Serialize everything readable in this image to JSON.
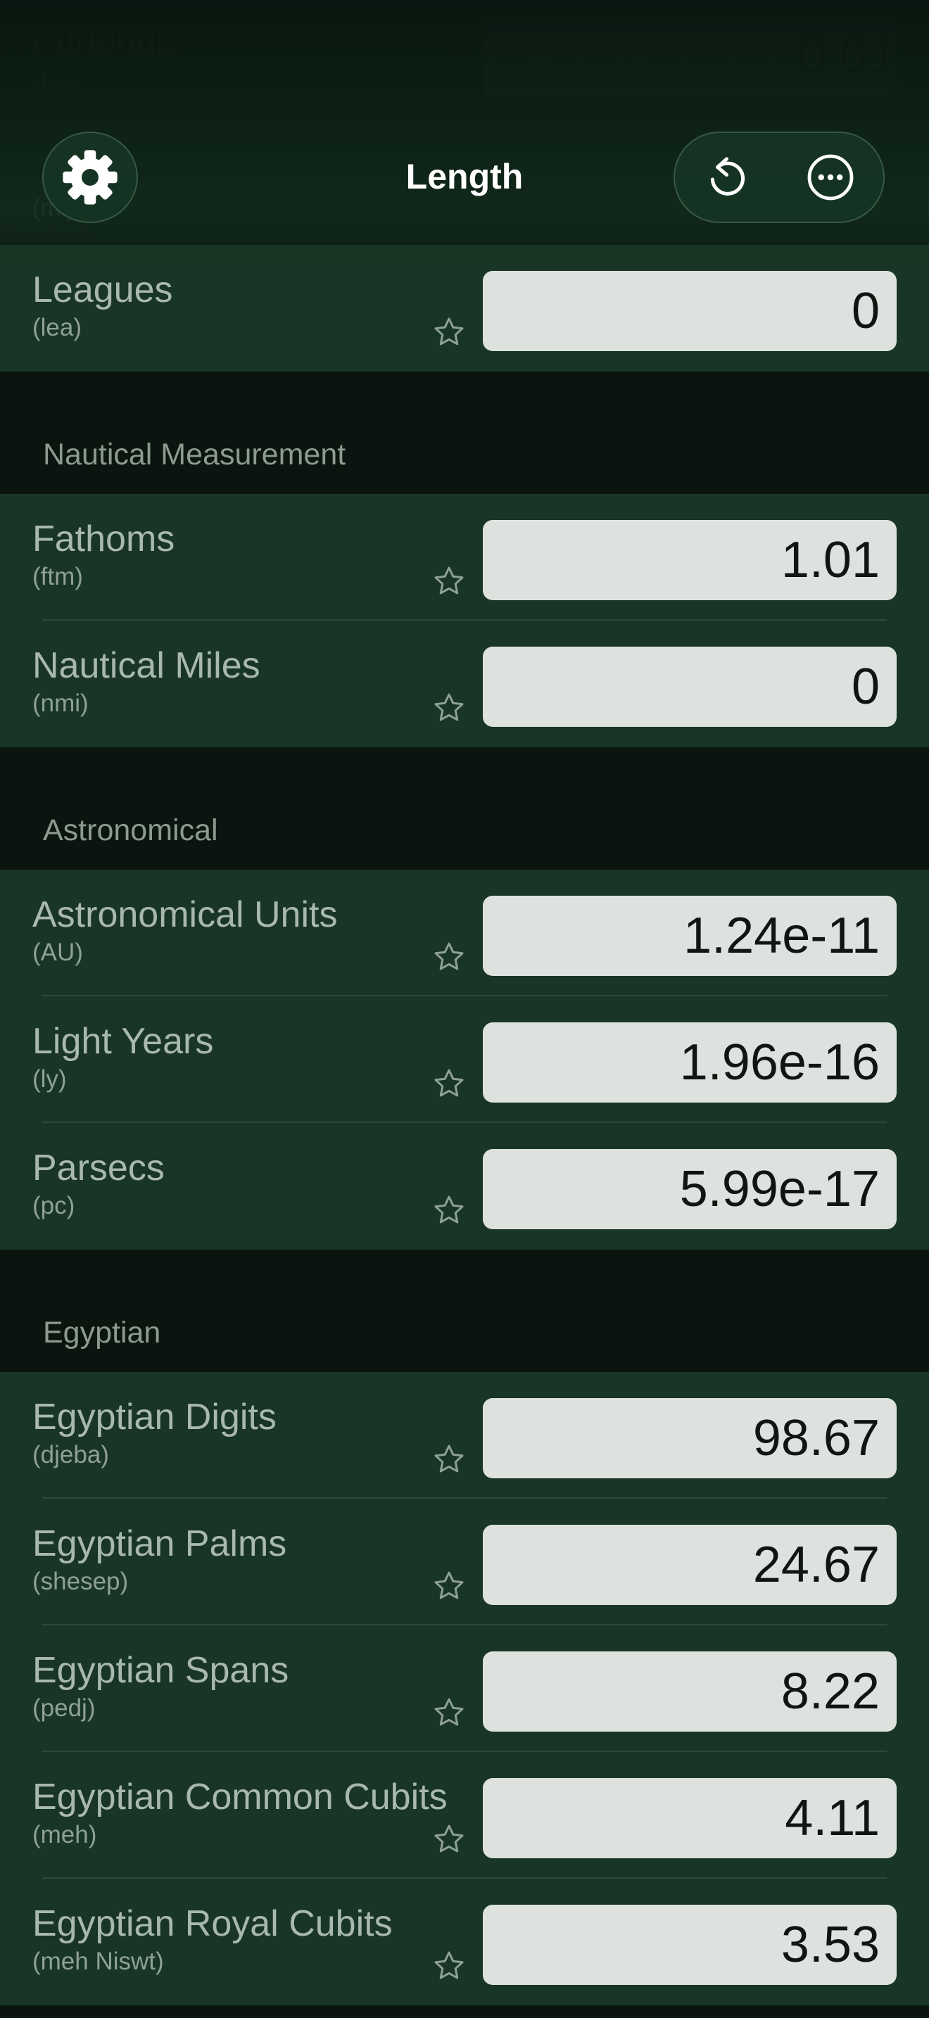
{
  "nav": {
    "title": "Length",
    "settings_icon": "gear-icon",
    "reset_icon": "rotate-ccw-icon",
    "more_icon": "ellipsis-circle-icon"
  },
  "ghost_rows": [
    {
      "name": "Furlongs",
      "abbr": "(fur)",
      "value": "0.01"
    },
    {
      "abbr": "(mi)"
    }
  ],
  "sections": [
    {
      "title": "",
      "units": [
        {
          "name": "Leagues",
          "abbr": "(lea)",
          "value": "0"
        }
      ]
    },
    {
      "title": "Nautical Measurement",
      "units": [
        {
          "name": "Fathoms",
          "abbr": "(ftm)",
          "value": "1.01"
        },
        {
          "name": "Nautical Miles",
          "abbr": "(nmi)",
          "value": "0"
        }
      ]
    },
    {
      "title": "Astronomical",
      "units": [
        {
          "name": "Astronomical Units",
          "abbr": "(AU)",
          "value": "1.24e-11"
        },
        {
          "name": "Light Years",
          "abbr": "(ly)",
          "value": "1.96e-16"
        },
        {
          "name": "Parsecs",
          "abbr": "(pc)",
          "value": "5.99e-17"
        }
      ]
    },
    {
      "title": "Egyptian",
      "units": [
        {
          "name": "Egyptian Digits",
          "abbr": "(djeba)",
          "value": "98.67"
        },
        {
          "name": "Egyptian Palms",
          "abbr": "(shesep)",
          "value": "24.67"
        },
        {
          "name": "Egyptian Spans",
          "abbr": "(pedj)",
          "value": "8.22"
        },
        {
          "name": "Egyptian Common Cubits",
          "abbr": "(meh)",
          "value": "4.11"
        },
        {
          "name": "Egyptian Royal Cubits",
          "abbr": "(meh Niswt)",
          "value": "3.53"
        }
      ]
    }
  ],
  "colors": {
    "background": "#0a150f",
    "row": "#183525",
    "field": "#dde2de",
    "accent": "#ffffff"
  }
}
